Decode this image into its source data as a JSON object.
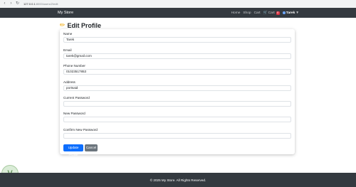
{
  "browser": {
    "url_host": "127.0.0.1",
    "url_path": ":8000/users/2/edit"
  },
  "navbar": {
    "brand": "My Store",
    "links": [
      "Home",
      "Shop",
      "Cart"
    ],
    "cart_label": "Cart",
    "cart_count": "0",
    "user_name": "Tarek"
  },
  "page": {
    "title": "Edit Profile"
  },
  "form": {
    "fields": [
      {
        "label": "Name",
        "value": "Tarek"
      },
      {
        "label": "Email",
        "value": "tarek@gmail.com"
      },
      {
        "label": "Phone Number",
        "value": "01023517853"
      },
      {
        "label": "Address",
        "value": "portsaid"
      },
      {
        "label": "Current Password",
        "value": ""
      },
      {
        "label": "New Password",
        "value": ""
      },
      {
        "label": "Confirm New Password",
        "value": ""
      }
    ],
    "submit_label": "Update Profile",
    "cancel_label": "Cancel"
  },
  "footer": {
    "text": "© 2025 My Store. All Rights Reserved."
  },
  "colors": {
    "navbar_bg": "#343a40",
    "primary": "#0d6efd",
    "secondary": "#6c757d",
    "badge": "#dc3545"
  },
  "icons": {
    "title_icon": "pencil-icon",
    "user_icon": "user-icon"
  }
}
